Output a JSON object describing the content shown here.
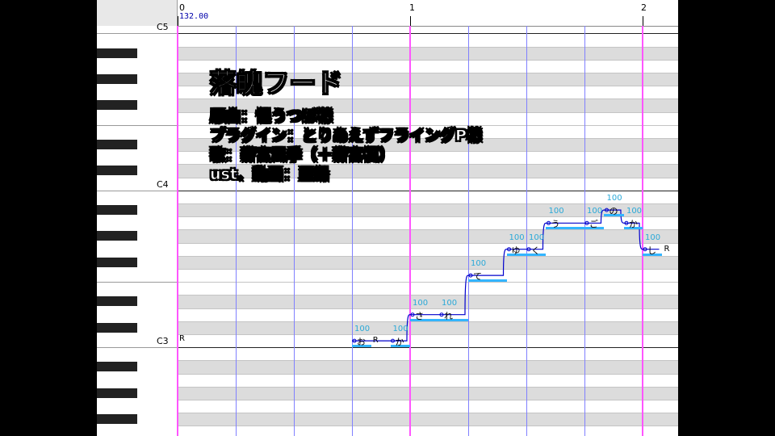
{
  "ruler": {
    "measures": [
      "0",
      "1",
      "2"
    ],
    "tempo": "132.00"
  },
  "keyboard": {
    "octaves": [
      "C5",
      "C4",
      "C3"
    ]
  },
  "overlay": {
    "title": "落魄フード",
    "lines": [
      "原曲：悒うつぼ様",
      "プラグイン：とりあえずフライングP様",
      "歌：薪宮風季（＋薪宮楓）",
      "ust、動画：亜鉛"
    ]
  },
  "notes": [
    {
      "lyric": "お",
      "velocity": "100",
      "start": 3.0,
      "length": 0.33,
      "pitch": 0
    },
    {
      "lyric": "か",
      "velocity": "100",
      "start": 3.66,
      "length": 0.34,
      "pitch": 0
    },
    {
      "lyric": "さ",
      "velocity": "100",
      "start": 4.0,
      "length": 0.5,
      "pitch": 2
    },
    {
      "lyric": "れ",
      "velocity": "100",
      "start": 4.5,
      "length": 0.5,
      "pitch": 2
    },
    {
      "lyric": "て",
      "velocity": "100",
      "start": 5.0,
      "length": 0.66,
      "pitch": 5
    },
    {
      "lyric": "ゆ",
      "velocity": "100",
      "start": 5.66,
      "length": 0.34,
      "pitch": 7
    },
    {
      "lyric": "く",
      "velocity": "100",
      "start": 6.0,
      "length": 0.34,
      "pitch": 7
    },
    {
      "lyric": "う",
      "velocity": "100",
      "start": 6.34,
      "length": 0.66,
      "pitch": 9
    },
    {
      "lyric": "ご",
      "velocity": "100",
      "start": 7.0,
      "length": 0.34,
      "pitch": 9
    },
    {
      "lyric": "の",
      "velocity": "100",
      "start": 7.34,
      "length": 0.34,
      "pitch": 10
    },
    {
      "lyric": "か",
      "velocity": "100",
      "start": 7.68,
      "length": 0.32,
      "pitch": 9
    },
    {
      "lyric": "し",
      "velocity": "100",
      "start": 8.0,
      "length": 0.34,
      "pitch": 7
    }
  ],
  "rests": [
    {
      "lyric": "R",
      "start": 0.0,
      "pitch": -1
    },
    {
      "lyric": "R",
      "start": 3.33,
      "pitch": 0
    },
    {
      "lyric": "R",
      "start": 8.34,
      "pitch": 7
    }
  ],
  "colors": {
    "note": "#33b5ff",
    "velocity": "#2aa9d8",
    "bar_line": "#ff55ff",
    "beat_line": "#8080ff",
    "pitch_curve": "#0000cc"
  }
}
